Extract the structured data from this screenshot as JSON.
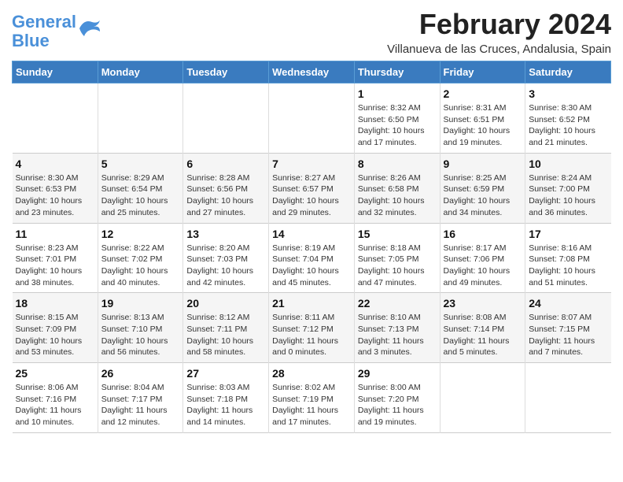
{
  "header": {
    "logo_line1": "General",
    "logo_line2": "Blue",
    "main_title": "February 2024",
    "sub_title": "Villanueva de las Cruces, Andalusia, Spain"
  },
  "weekdays": [
    "Sunday",
    "Monday",
    "Tuesday",
    "Wednesday",
    "Thursday",
    "Friday",
    "Saturday"
  ],
  "weeks": [
    [
      {
        "day": "",
        "info": ""
      },
      {
        "day": "",
        "info": ""
      },
      {
        "day": "",
        "info": ""
      },
      {
        "day": "",
        "info": ""
      },
      {
        "day": "1",
        "info": "Sunrise: 8:32 AM\nSunset: 6:50 PM\nDaylight: 10 hours\nand 17 minutes."
      },
      {
        "day": "2",
        "info": "Sunrise: 8:31 AM\nSunset: 6:51 PM\nDaylight: 10 hours\nand 19 minutes."
      },
      {
        "day": "3",
        "info": "Sunrise: 8:30 AM\nSunset: 6:52 PM\nDaylight: 10 hours\nand 21 minutes."
      }
    ],
    [
      {
        "day": "4",
        "info": "Sunrise: 8:30 AM\nSunset: 6:53 PM\nDaylight: 10 hours\nand 23 minutes."
      },
      {
        "day": "5",
        "info": "Sunrise: 8:29 AM\nSunset: 6:54 PM\nDaylight: 10 hours\nand 25 minutes."
      },
      {
        "day": "6",
        "info": "Sunrise: 8:28 AM\nSunset: 6:56 PM\nDaylight: 10 hours\nand 27 minutes."
      },
      {
        "day": "7",
        "info": "Sunrise: 8:27 AM\nSunset: 6:57 PM\nDaylight: 10 hours\nand 29 minutes."
      },
      {
        "day": "8",
        "info": "Sunrise: 8:26 AM\nSunset: 6:58 PM\nDaylight: 10 hours\nand 32 minutes."
      },
      {
        "day": "9",
        "info": "Sunrise: 8:25 AM\nSunset: 6:59 PM\nDaylight: 10 hours\nand 34 minutes."
      },
      {
        "day": "10",
        "info": "Sunrise: 8:24 AM\nSunset: 7:00 PM\nDaylight: 10 hours\nand 36 minutes."
      }
    ],
    [
      {
        "day": "11",
        "info": "Sunrise: 8:23 AM\nSunset: 7:01 PM\nDaylight: 10 hours\nand 38 minutes."
      },
      {
        "day": "12",
        "info": "Sunrise: 8:22 AM\nSunset: 7:02 PM\nDaylight: 10 hours\nand 40 minutes."
      },
      {
        "day": "13",
        "info": "Sunrise: 8:20 AM\nSunset: 7:03 PM\nDaylight: 10 hours\nand 42 minutes."
      },
      {
        "day": "14",
        "info": "Sunrise: 8:19 AM\nSunset: 7:04 PM\nDaylight: 10 hours\nand 45 minutes."
      },
      {
        "day": "15",
        "info": "Sunrise: 8:18 AM\nSunset: 7:05 PM\nDaylight: 10 hours\nand 47 minutes."
      },
      {
        "day": "16",
        "info": "Sunrise: 8:17 AM\nSunset: 7:06 PM\nDaylight: 10 hours\nand 49 minutes."
      },
      {
        "day": "17",
        "info": "Sunrise: 8:16 AM\nSunset: 7:08 PM\nDaylight: 10 hours\nand 51 minutes."
      }
    ],
    [
      {
        "day": "18",
        "info": "Sunrise: 8:15 AM\nSunset: 7:09 PM\nDaylight: 10 hours\nand 53 minutes."
      },
      {
        "day": "19",
        "info": "Sunrise: 8:13 AM\nSunset: 7:10 PM\nDaylight: 10 hours\nand 56 minutes."
      },
      {
        "day": "20",
        "info": "Sunrise: 8:12 AM\nSunset: 7:11 PM\nDaylight: 10 hours\nand 58 minutes."
      },
      {
        "day": "21",
        "info": "Sunrise: 8:11 AM\nSunset: 7:12 PM\nDaylight: 11 hours\nand 0 minutes."
      },
      {
        "day": "22",
        "info": "Sunrise: 8:10 AM\nSunset: 7:13 PM\nDaylight: 11 hours\nand 3 minutes."
      },
      {
        "day": "23",
        "info": "Sunrise: 8:08 AM\nSunset: 7:14 PM\nDaylight: 11 hours\nand 5 minutes."
      },
      {
        "day": "24",
        "info": "Sunrise: 8:07 AM\nSunset: 7:15 PM\nDaylight: 11 hours\nand 7 minutes."
      }
    ],
    [
      {
        "day": "25",
        "info": "Sunrise: 8:06 AM\nSunset: 7:16 PM\nDaylight: 11 hours\nand 10 minutes."
      },
      {
        "day": "26",
        "info": "Sunrise: 8:04 AM\nSunset: 7:17 PM\nDaylight: 11 hours\nand 12 minutes."
      },
      {
        "day": "27",
        "info": "Sunrise: 8:03 AM\nSunset: 7:18 PM\nDaylight: 11 hours\nand 14 minutes."
      },
      {
        "day": "28",
        "info": "Sunrise: 8:02 AM\nSunset: 7:19 PM\nDaylight: 11 hours\nand 17 minutes."
      },
      {
        "day": "29",
        "info": "Sunrise: 8:00 AM\nSunset: 7:20 PM\nDaylight: 11 hours\nand 19 minutes."
      },
      {
        "day": "",
        "info": ""
      },
      {
        "day": "",
        "info": ""
      }
    ]
  ]
}
